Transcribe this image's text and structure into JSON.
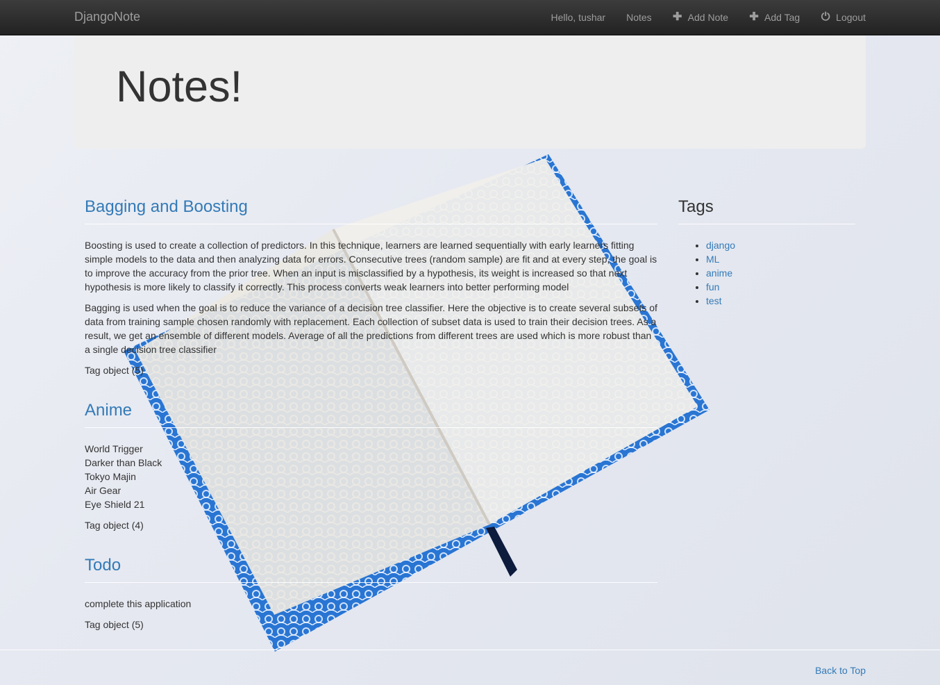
{
  "navbar": {
    "brand": "DjangoNote",
    "greeting": "Hello, tushar",
    "notes_link": "Notes",
    "add_note": "Add Note",
    "add_tag": "Add Tag",
    "logout": "Logout"
  },
  "jumbotron": {
    "title": "Notes!"
  },
  "notes": [
    {
      "title": "Bagging and Boosting",
      "paragraphs": [
        "Boosting is used to create a collection of predictors. In this technique, learners are learned sequentially with early learners fitting simple models to the data and then analyzing data for errors. Consecutive trees (random sample) are fit and at every step, the goal is to improve the accuracy from the prior tree. When an input is misclassified by a hypothesis, its weight is increased so that next hypothesis is more likely to classify it correctly. This process converts weak learners into better performing model",
        "Bagging is used when the goal is to reduce the variance of a decision tree classifier. Here the objective is to create several subsets of data from training sample chosen randomly with replacement. Each collection of subset data is used to train their decision trees. As a result, we get an ensemble of different models. Average of all the predictions from different trees are used which is more robust than a single decision tree classifier"
      ],
      "tag": "Tag object (5)"
    },
    {
      "title": "Anime",
      "lines": [
        "World Trigger",
        "Darker than Black",
        "Tokyo Majin",
        "Air Gear",
        "Eye Shield 21"
      ],
      "tag": "Tag object (4)"
    },
    {
      "title": "Todo",
      "lines": [
        "complete this application"
      ],
      "tag": "Tag object (5)"
    }
  ],
  "sidebar": {
    "title": "Tags",
    "tags": [
      "django",
      "ML",
      "anime",
      "fun",
      "test"
    ]
  },
  "footer": {
    "back_to_top": "Back to Top"
  }
}
